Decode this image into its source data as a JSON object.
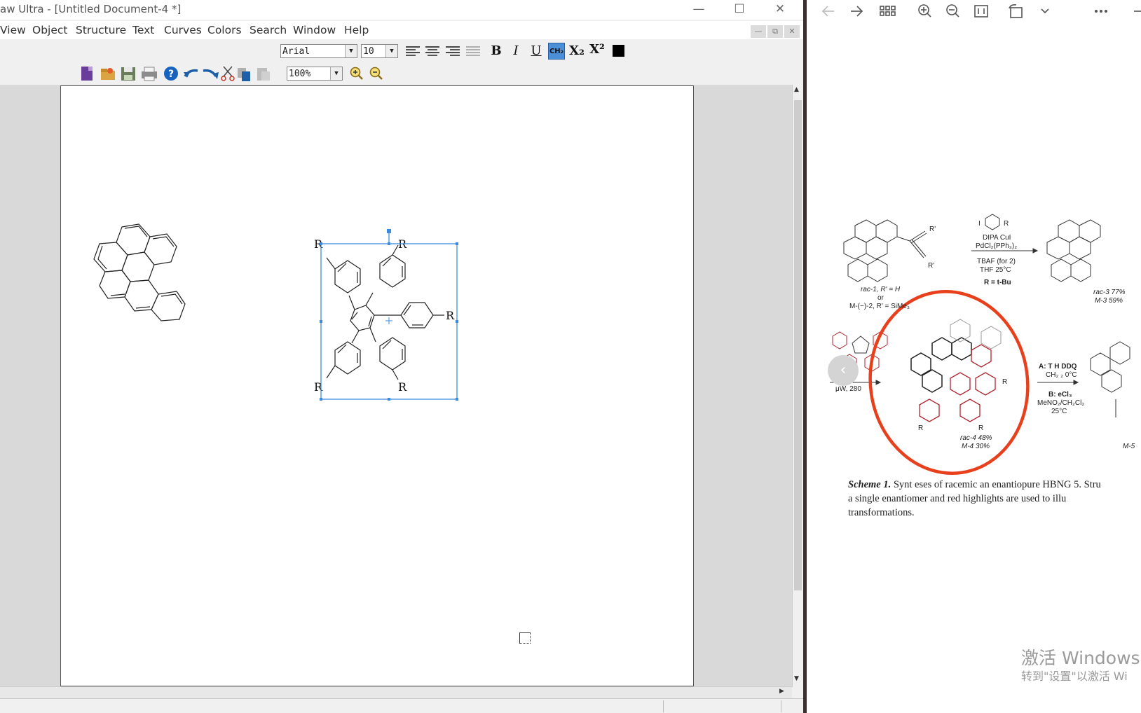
{
  "app": {
    "title": "aw Ultra - [Untitled Document-4 *]",
    "menu": [
      "View",
      "Object",
      "Structure",
      "Text",
      "Curves",
      "Colors",
      "Search",
      "Window",
      "Help"
    ],
    "font_family_value": "Arial",
    "font_size_value": "10",
    "zoom_value": "100%",
    "bold_label": "B",
    "italic_label": "I",
    "underline_label": "U",
    "ch2_label": "CH₂",
    "subscript_label": "X₂",
    "superscript_label": "X²",
    "structure_labels": {
      "r_top_left": "R",
      "r_top_right": "R",
      "r_right": "R",
      "r_bottom_left": "R",
      "r_bottom_right": "R"
    }
  },
  "viewer": {
    "figure_labels": {
      "r_prime_top": "R'",
      "r_prime_bottom": "R'",
      "reagent_i": "I",
      "reagent_r": "R",
      "dipa": "DIPA CuI",
      "pdcl": "PdCl₂(PPh₃)₂",
      "tbaf": "TBAF (for 2)",
      "thf": "THF 25°C",
      "r_tbu": "R = t-Bu",
      "rac1": "rac-1, R' = H",
      "or": "or",
      "m2": "M-(−)-2, R' = SiMe₃",
      "rac3": "rac-3 77%",
      "m3": "M-3 59%",
      "mw": "μW, 280",
      "cond_a": "A: T  H DDQ",
      "cond_a2": "CH₂  ₂ 0°C",
      "cond_b": "B:  eCl₃",
      "cond_b2": "MeNO₂/CH₂Cl₂",
      "cond_b3": "25°C",
      "rac4": "rac-4 48%",
      "m4": "M-4 30%",
      "m5": "M-5",
      "r_label": "R"
    },
    "caption_line1_bold": "Scheme 1.",
    "caption_line1": " Synt  eses of racemic an   enantiopure HBNG 5. Stru",
    "caption_line2": "a single enantiomer      and red highlights are used to illu",
    "caption_line3": "transformations.",
    "watermark_line1": "激活 Windows",
    "watermark_line2": "转到\"设置\"以激活 Wi"
  },
  "colors": {
    "selection": "#3b8be0",
    "annotation_circle": "#e8401c",
    "highlight_red": "#b0242f"
  }
}
